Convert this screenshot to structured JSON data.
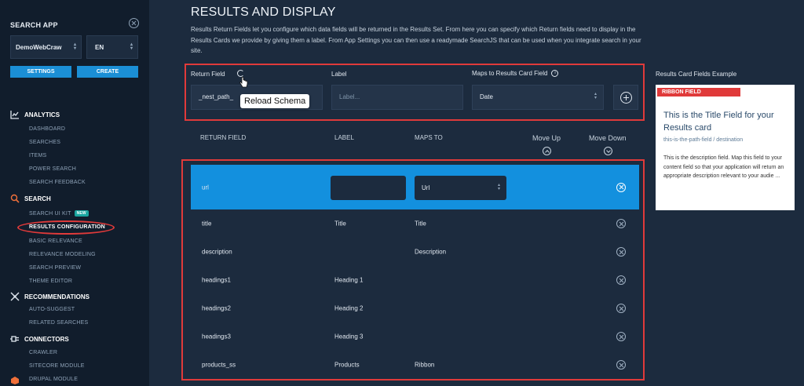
{
  "sidebar": {
    "app_title": "SEARCH APP",
    "app_select": "DemoWebCraw",
    "lang_select": "EN",
    "settings_label": "SETTINGS",
    "create_label": "CREATE",
    "analytics": {
      "label": "ANALYTICS",
      "items": [
        "DASHBOARD",
        "SEARCHES",
        "ITEMS",
        "POWER SEARCH",
        "SEARCH FEEDBACK"
      ]
    },
    "search": {
      "label": "SEARCH",
      "items": [
        "SEARCH UI KIT",
        "RESULTS CONFIGURATION",
        "BASIC RELEVANCE",
        "RELEVANCE MODELING",
        "SEARCH PREVIEW",
        "THEME EDITOR"
      ],
      "new_badge": "NEW"
    },
    "recommendations": {
      "label": "RECOMMENDATIONS",
      "items": [
        "AUTO-SUGGEST",
        "RELATED SEARCHES"
      ]
    },
    "connectors": {
      "label": "CONNECTORS",
      "items": [
        "CRAWLER",
        "SITECORE MODULE",
        "DRUPAL MODULE"
      ]
    }
  },
  "main": {
    "title": "RESULTS AND DISPLAY",
    "description": "Results Return Fields let you configure which data fields will be returned in the Results Set. From here you can specify which Return fields need to display in the Results Cards we provide by giving them a label. From App Settings you can then use a readymade SearchJS that can be used when you integrate search in your site.",
    "form": {
      "return_field_label": "Return Field",
      "return_field_value": "_nest_path_",
      "label_label": "Label",
      "label_placeholder": "Label...",
      "maps_label": "Maps to Results Card Field",
      "maps_value": "Date",
      "tooltip": "Reload Schema"
    },
    "table": {
      "headers": {
        "return_field": "RETURN FIELD",
        "label": "LABEL",
        "maps_to": "MAPS TO",
        "move_up": "Move Up",
        "move_down": "Move Down"
      },
      "selected_row": {
        "field": "url",
        "maps": "Url"
      },
      "rows": [
        {
          "field": "title",
          "label": "Title",
          "maps": "Title"
        },
        {
          "field": "description",
          "label": "",
          "maps": "Description"
        },
        {
          "field": "headings1",
          "label": "Heading 1",
          "maps": ""
        },
        {
          "field": "headings2",
          "label": "Heading 2",
          "maps": ""
        },
        {
          "field": "headings3",
          "label": "Heading 3",
          "maps": ""
        },
        {
          "field": "products_ss",
          "label": "Products",
          "maps": "Ribbon"
        }
      ]
    }
  },
  "card_example": {
    "heading": "Results Card Fields Example",
    "ribbon": "RIBBON FIELD",
    "title": "This is the Title Field for your Results card",
    "path": "this-is-the-path-field / destination",
    "description": "This is the description field. Map this field to your content field so that your application will return an appropriate description relevant to your audie ..."
  },
  "colors": {
    "accent_blue": "#1390de",
    "highlight_red": "#e03a3a",
    "sidebar_bg": "#111d2c",
    "main_bg": "#1c2b3e"
  }
}
